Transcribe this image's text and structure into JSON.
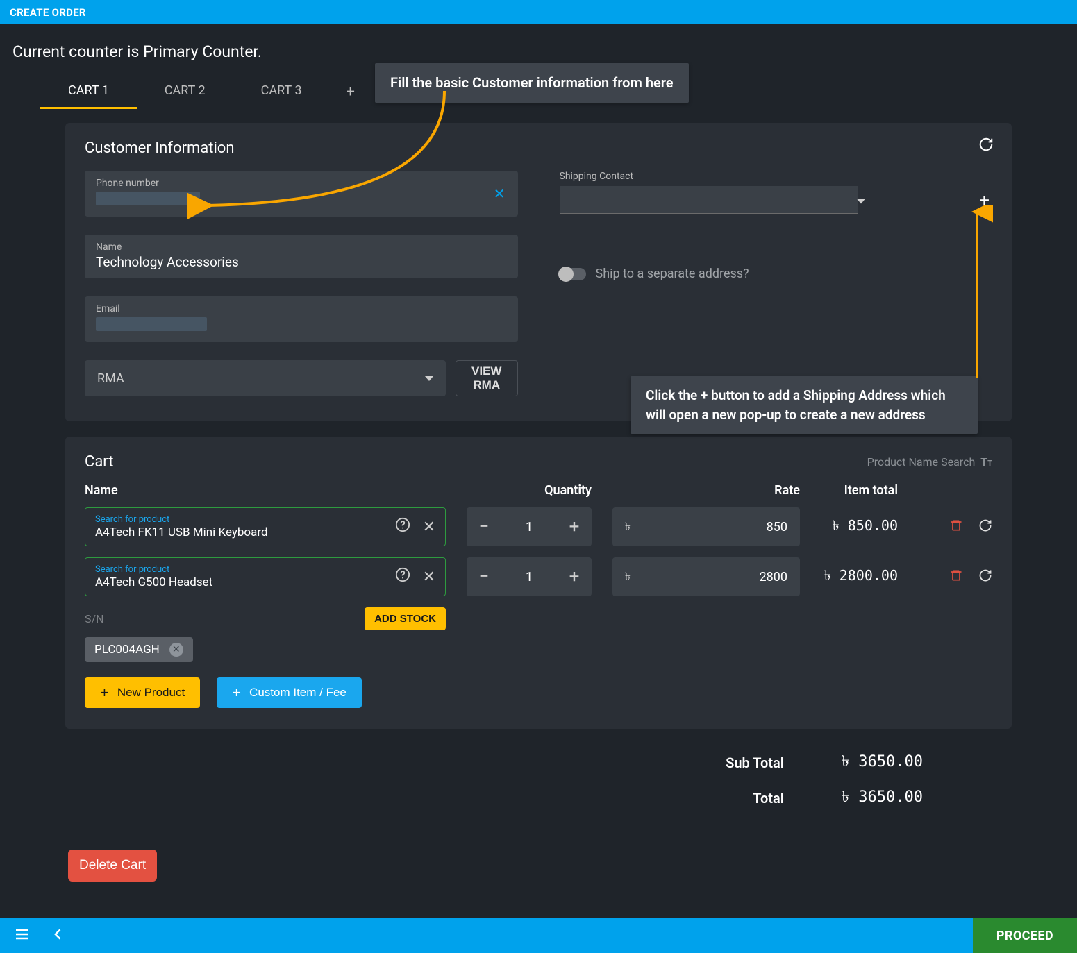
{
  "header": {
    "title": "CREATE ORDER"
  },
  "counter_text": "Current counter is Primary Counter.",
  "tabs": {
    "items": [
      "CART 1",
      "CART 2",
      "CART 3"
    ],
    "active": 0
  },
  "callouts": {
    "c1": "Fill the basic Customer information from here",
    "c2": "Click the + button to add a Shipping Address which will open a new pop-up to create a new address"
  },
  "customer": {
    "section_title": "Customer Information",
    "phone_label": "Phone number",
    "phone_value": "",
    "name_label": "Name",
    "name_value": "Technology Accessories",
    "email_label": "Email",
    "email_value": "",
    "shipping_contact_label": "Shipping Contact",
    "shipping_contact_value": "",
    "ship_separate_label": "Ship to a separate address?",
    "rma_label": "RMA",
    "view_rma_label": "VIEW RMA"
  },
  "cart": {
    "section_title": "Cart",
    "product_name_search": "Product Name Search",
    "columns": {
      "name": "Name",
      "quantity": "Quantity",
      "rate": "Rate",
      "item_total": "Item total"
    },
    "search_label": "Search for product",
    "rows": [
      {
        "product": "A4Tech FK11 USB Mini Keyboard",
        "qty": "1",
        "rate": "850",
        "total": "850.00"
      },
      {
        "product": "A4Tech G500 Headset",
        "qty": "1",
        "rate": "2800",
        "total": "2800.00"
      }
    ],
    "sn_label": "S/N",
    "add_stock_label": "ADD STOCK",
    "serial_chip": "PLC004AGH",
    "new_product_label": "New Product",
    "custom_item_label": "Custom Item / Fee"
  },
  "totals": {
    "subtotal_label": "Sub Total",
    "subtotal_value": "3650.00",
    "total_label": "Total",
    "total_value": "3650.00"
  },
  "delete_cart_label": "Delete Cart",
  "proceed_label": "PROCEED",
  "currency_symbol": "৳"
}
